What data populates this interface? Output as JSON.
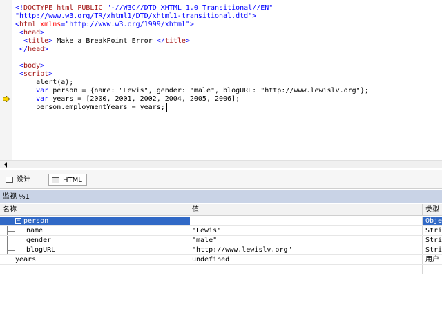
{
  "editor": {
    "lines": [
      {
        "parts": [
          {
            "c": "b",
            "t": "<!"
          },
          {
            "c": "m",
            "t": "DOCTYPE html PUBLIC "
          },
          {
            "c": "b",
            "t": "\"-//W3C//DTD XHTML 1.0 Transitional//EN\""
          }
        ]
      },
      {
        "parts": [
          {
            "c": "b",
            "t": "\"http://www.w3.org/TR/xhtml1/DTD/xhtml1-transitional.dtd\">"
          }
        ]
      },
      {
        "parts": [
          {
            "c": "b",
            "t": "<"
          },
          {
            "c": "m",
            "t": "html "
          },
          {
            "c": "r",
            "t": "xmlns"
          },
          {
            "c": "b",
            "t": "=\"http://www.w3.org/1999/xhtml\">"
          }
        ]
      },
      {
        "parts": [
          {
            "c": "b",
            "t": " <"
          },
          {
            "c": "m",
            "t": "head"
          },
          {
            "c": "b",
            "t": ">"
          }
        ]
      },
      {
        "parts": [
          {
            "c": "b",
            "t": "  <"
          },
          {
            "c": "m",
            "t": "title"
          },
          {
            "c": "b",
            "t": "> "
          },
          {
            "c": "t",
            "t": "Make a BreakPoint Error "
          },
          {
            "c": "b",
            "t": "</"
          },
          {
            "c": "m",
            "t": "title"
          },
          {
            "c": "b",
            "t": ">"
          }
        ]
      },
      {
        "parts": [
          {
            "c": "b",
            "t": " </"
          },
          {
            "c": "m",
            "t": "head"
          },
          {
            "c": "b",
            "t": ">"
          }
        ]
      },
      {
        "parts": []
      },
      {
        "parts": [
          {
            "c": "b",
            "t": " <"
          },
          {
            "c": "m",
            "t": "body"
          },
          {
            "c": "b",
            "t": ">"
          }
        ]
      },
      {
        "parts": [
          {
            "c": "b",
            "t": " <"
          },
          {
            "c": "m",
            "t": "script"
          },
          {
            "c": "b",
            "t": ">"
          }
        ]
      },
      {
        "parts": [
          {
            "c": "t",
            "t": "     alert(a);"
          }
        ]
      },
      {
        "parts": [
          {
            "c": "k",
            "t": "     var "
          },
          {
            "c": "t",
            "t": "person = {name: \"Lewis\", gender: \"male\", blogURL: \"http://www.lewislv.org\"};"
          }
        ]
      },
      {
        "parts": [
          {
            "c": "k",
            "t": "     var "
          },
          {
            "c": "t",
            "t": "years = [2000, 2001, 2002, 2004, 2005, 2006];"
          }
        ]
      },
      {
        "parts": [
          {
            "c": "t",
            "t": "     person.employmentYears = years;"
          }
        ]
      }
    ]
  },
  "view_tabs": {
    "design": "设计",
    "html": "HTML"
  },
  "watch": {
    "title": "监视 %1",
    "columns": {
      "name": "名称",
      "value": "值",
      "type": "类型"
    },
    "rows": [
      {
        "name": "person",
        "value": "",
        "type": "Obje",
        "selected": true,
        "expanded": true,
        "level": 0
      },
      {
        "name": "name",
        "value": "\"Lewis\"",
        "type": "Stri",
        "level": 1
      },
      {
        "name": "gender",
        "value": "\"male\"",
        "type": "Stri",
        "level": 1
      },
      {
        "name": "blogURL",
        "value": "\"http://www.lewislv.org\"",
        "type": "Stri",
        "level": 1
      },
      {
        "name": "years",
        "value": "undefined",
        "type": "用户",
        "level": 0
      },
      {
        "name": "",
        "value": "",
        "type": "",
        "level": 0
      }
    ]
  },
  "icons": {
    "breakpoint_arrow": "current-statement-arrow-icon",
    "expander": "collapse-minus-icon"
  },
  "colors": {
    "selection": "#3169c6",
    "watch_title_bg": "#c9d3e6",
    "arrow_fill": "#ffd800"
  }
}
